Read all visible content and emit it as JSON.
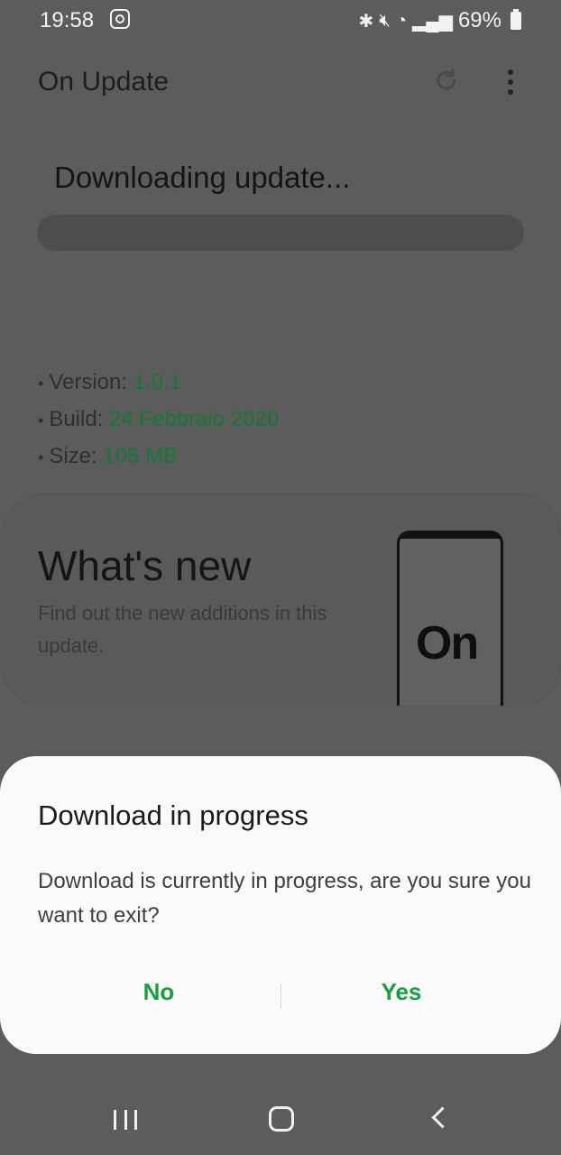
{
  "status_bar": {
    "time": "19:58",
    "battery": "69%",
    "icons": [
      "instagram-icon",
      "bluetooth-icon",
      "mute-icon",
      "wifi-icon",
      "signal-icon",
      "battery-icon"
    ]
  },
  "app_bar": {
    "title": "On Update",
    "icons": [
      "refresh-icon",
      "more-vert-icon"
    ]
  },
  "download": {
    "title": "Downloading update...",
    "progress": 0
  },
  "info": {
    "version_label": "Version: ",
    "version_value": "1.0.1",
    "build_label": "Build: ",
    "build_value": "24 Febbraio 2020",
    "size_label": "Size: ",
    "size_value": "105 MB"
  },
  "whats_new": {
    "title": "What's new",
    "description": "Find out the new additions in this update.",
    "logo_text": "On"
  },
  "dialog": {
    "title": "Download in progress",
    "message": "Download is currently in progress, are you sure you want to exit?",
    "no_label": "No",
    "yes_label": "Yes"
  },
  "nav_bar": {
    "icons": [
      "recent-apps-icon",
      "home-icon",
      "back-icon"
    ]
  },
  "colors": {
    "accent": "#17a03f",
    "scrim": "#5c5c5c",
    "dialog_bg": "#fafafa"
  }
}
